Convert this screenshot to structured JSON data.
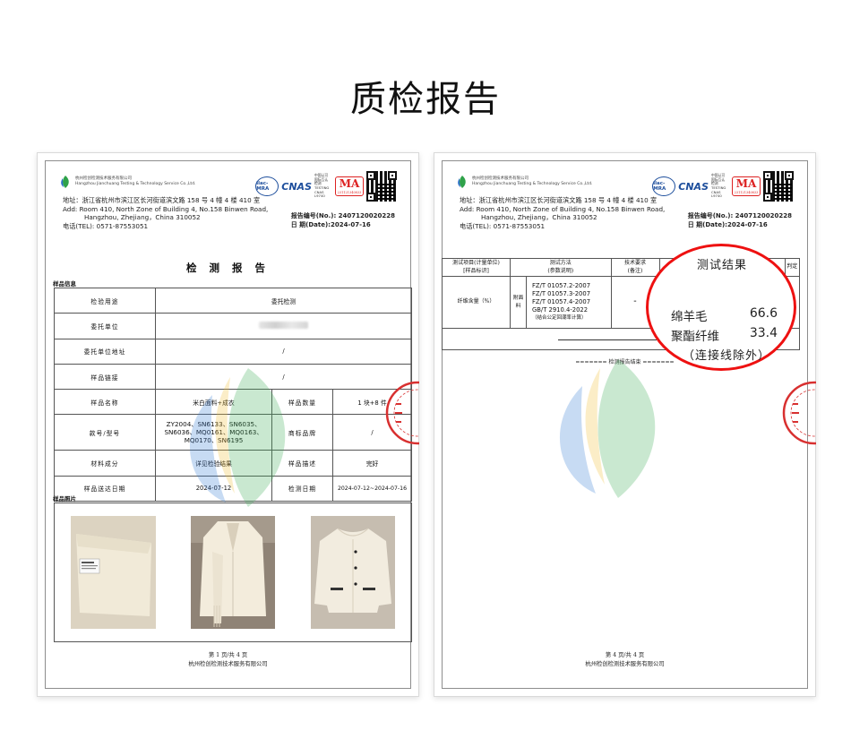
{
  "page_title": "质检报告",
  "lab": {
    "name_cn": "杭州检创检测技术服务有限公司",
    "name_en": "Hangzhou Jianchuang Testing & Technology Service Co.,Ltd.",
    "ilac_label": "ilac-MRA",
    "cnas_label": "CNAS",
    "cnas_text": [
      "中国认可",
      "国际互认",
      "检测",
      "TESTING",
      "CNAS L9740"
    ],
    "ma_label": "MA",
    "ma_no": "231121340833"
  },
  "header": {
    "addr_cn": "地址：浙江省杭州市滨江区长河街道滨文路 158 号 4 幢 4 楼 410 室",
    "addr_en_1": "Add: Room 410, North Zone of Building 4, No.158 Binwen Road,",
    "addr_en_2": "Hangzhou, Zhejiang，China        310052",
    "tel": "电话(TEL):   0571-87553051",
    "report_no": "报告编号(No.): 2407120020228",
    "date": "日   期(Date):2024-07-16"
  },
  "report": {
    "title": "检 测 报 告",
    "section_sample_info": "样品信息",
    "section_photos": "样品照片",
    "rows": {
      "purpose_label": "检验用途",
      "purpose_value": "委托检测",
      "client_label": "委托单位",
      "client_addr_label": "委托单位地址",
      "client_addr_value": "/",
      "link_label": "样品链接",
      "link_value": "/",
      "name_label": "样品名称",
      "name_value": "米白面料+成衣",
      "qty_label": "样品数量",
      "qty_value": "1 块+8 件",
      "model_label": "款号/型号",
      "model_value": [
        "ZY2004、SN6133、SN6035、",
        "SN6036、MQ0161、MQ0163、",
        "MQ0170、SN6195"
      ],
      "brand_label": "商标品牌",
      "brand_value": "/",
      "material_label": "材料成分",
      "material_value": "详见检验结果",
      "desc_label": "样品描述",
      "desc_value": "完好",
      "received_label": "样品送达日期",
      "received_value": "2024-07-12",
      "test_date_label": "检测日期",
      "test_date_value": "2024-07-12~2024-07-16"
    },
    "footer_left": "第 1 页/共 4 页",
    "footer_right": "第 4 页/共 4 页",
    "footer_company": "杭州检创检测技术服务有限公司"
  },
  "result_table": {
    "h1a": "测试项目(计量单位)",
    "h1b": "[样品标识]",
    "h2a": "测试方法",
    "h2b": "(参数说明)",
    "h3a": "技术要求",
    "h3b": "(备注)",
    "h4": "判定",
    "item": "纤维含量（%）",
    "sub": "附面料",
    "standards": [
      "FZ/T 01057.2-2007",
      "FZ/T 01057.3-2007",
      "FZ/T 01057.4-2007",
      "GB/T 2910.4-2022"
    ],
    "std_note": "（结合公定回潮率计算）",
    "req": "-",
    "end": "======= 检测报告结束 ======="
  },
  "annotation": {
    "title": "测试结果",
    "row1_label": "绵羊毛",
    "row1_value": "66.6",
    "row2_label": "聚酯纤维",
    "row2_value": "33.4",
    "note": "（连接线除外）"
  },
  "colors": {
    "annotation_red": "#e11111",
    "cnas_blue": "#1d4e9c",
    "stamp_red": "#d83030"
  }
}
